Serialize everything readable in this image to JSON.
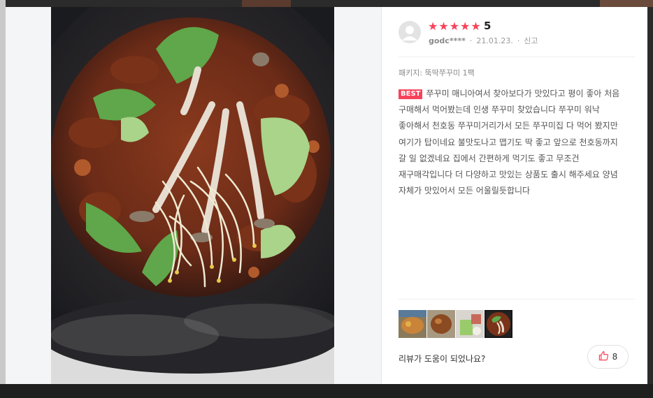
{
  "review": {
    "rating_value": "5",
    "stars": 5,
    "username": "godc****",
    "date": "21.01.23.",
    "report_label": "신고",
    "package_label": "패키지: 뚝딱쭈꾸미 1팩",
    "best_badge": "BEST",
    "text": "쭈꾸미 매니아여서 찾아보다가 맛있다고 평이 좋아 처음 구매해서 먹어봤는데 인생 쭈꾸미 찾았습니다 쭈꾸미 워낙 좋아해서 천호동 쭈꾸미거리가서 모든 쭈꾸미집 다 먹어 봤지만 여기가 탑이네요 불맛도나고 맵기도 딱 좋고 앞으로 천호동까지 갈 일 없겠네요 집에서 간편하게 먹기도 좋고 무조건 재구매각입니다 더 다양하고 맛있는 상품도 출시 해주세요 양념 자체가 맛있어서 모든 어울릴듯합니다",
    "helpful_question": "리뷰가 도움이 되었나요?",
    "helpful_count": "8",
    "thumbnails": 4,
    "selected_thumbnail": 4
  },
  "colors": {
    "star": "#f7435a",
    "best_badge": "#f7435a",
    "like_icon": "#f7435a"
  },
  "icons": {
    "star": "star-icon",
    "avatar": "user-avatar-icon",
    "like": "thumbs-up-icon"
  }
}
